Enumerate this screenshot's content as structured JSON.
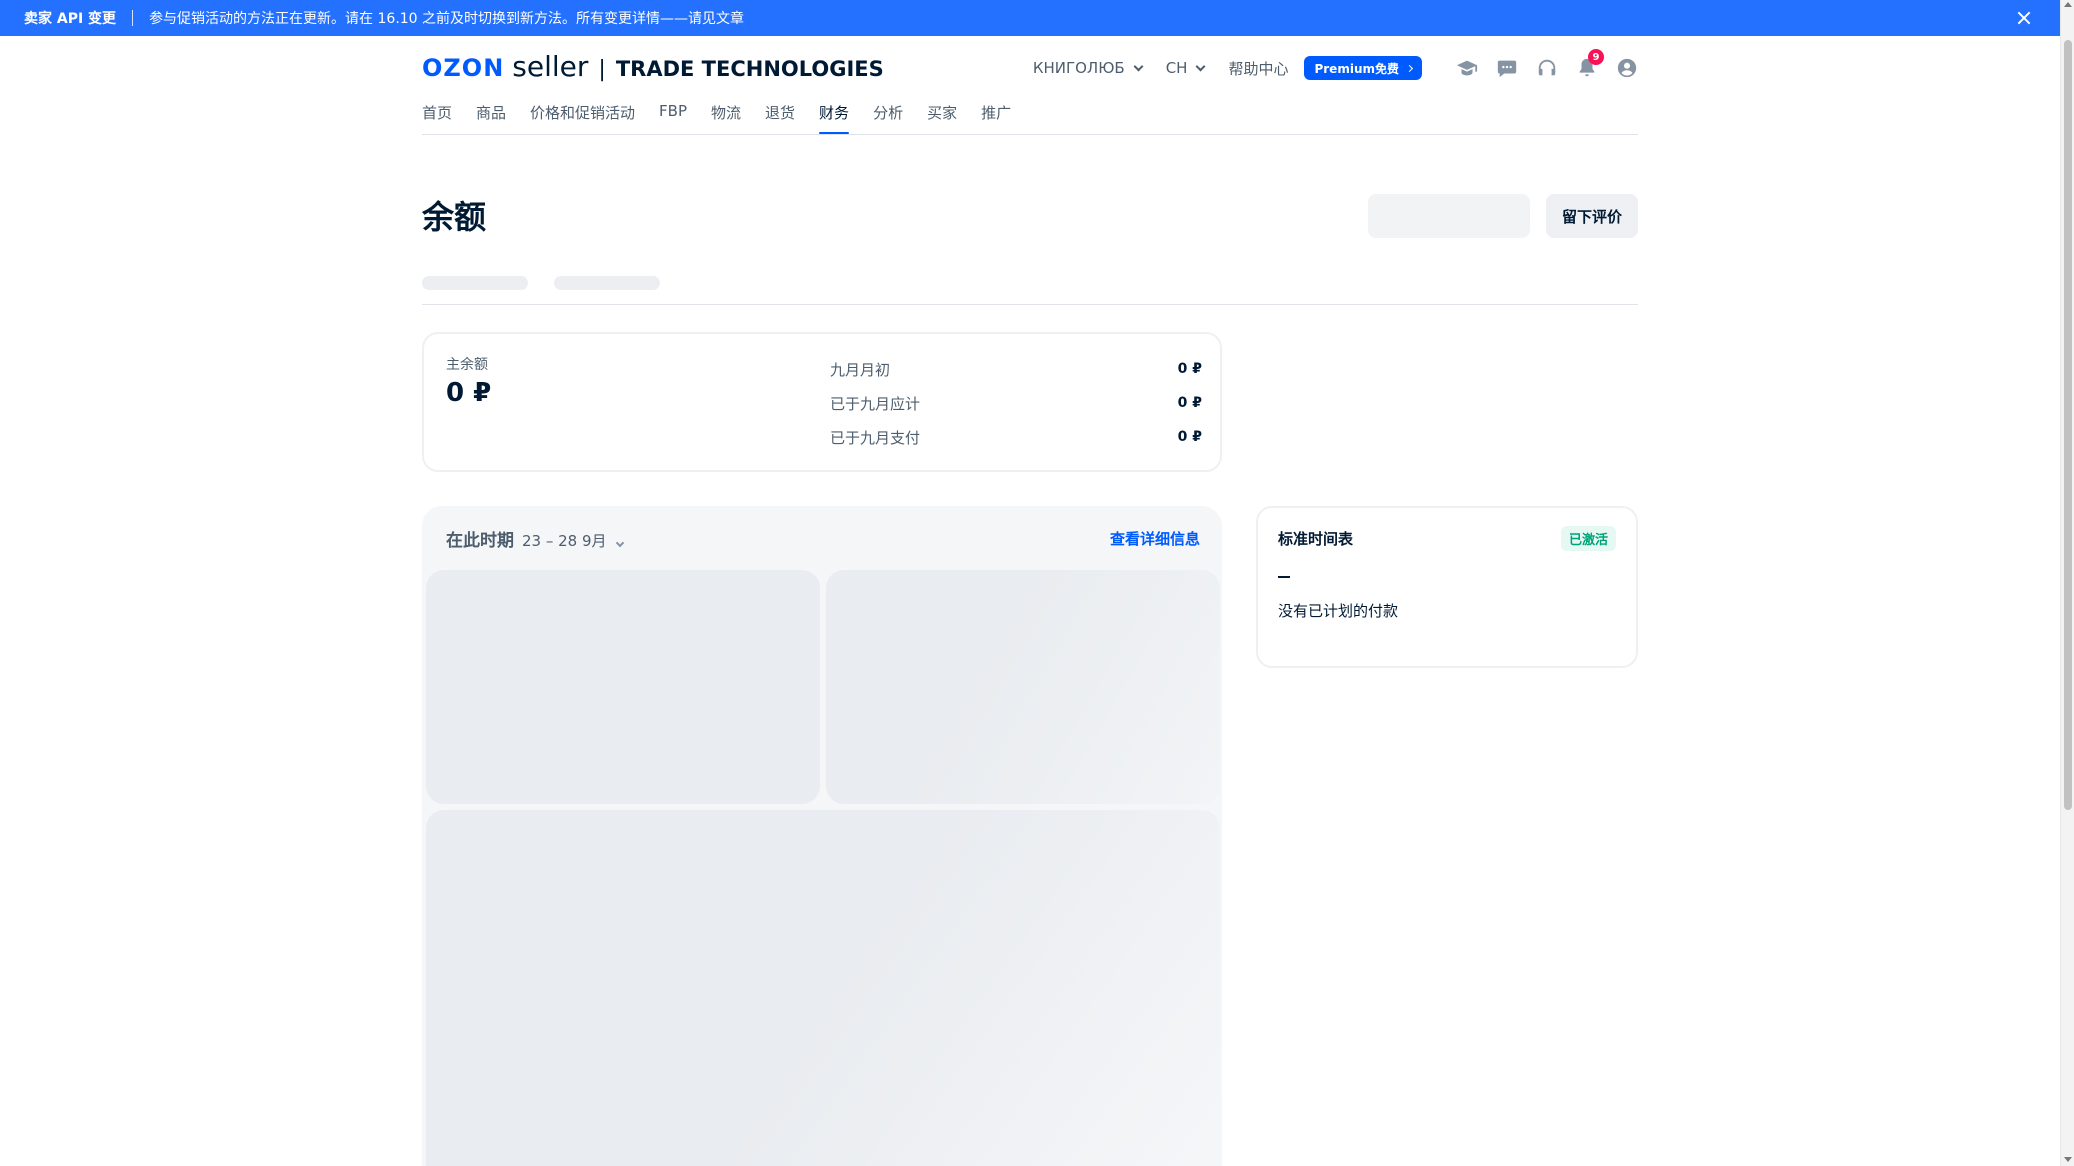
{
  "banner": {
    "tag": "卖家 API 变更",
    "message": "参与促销活动的方法正在更新。请在 16.10 之前及时切换到新方法。所有变更详情——请见文章"
  },
  "header": {
    "logo_ozon": "OZON",
    "logo_seller": "seller",
    "logo_bar": "|",
    "logo_trade": "TRADE TECHNOLOGIES",
    "company_select": "КНИГОЛЮБ",
    "lang_select": "CH",
    "help_center": "帮助中心",
    "premium": "Premium免费",
    "notifications_count": "9",
    "icons": [
      "graduation-cap-icon",
      "chat-icon",
      "headset-icon",
      "bell-icon",
      "user-icon"
    ]
  },
  "nav": {
    "items": [
      "首页",
      "商品",
      "价格和促销活动",
      "FBP",
      "物流",
      "退货",
      "财务",
      "分析",
      "买家",
      "推广"
    ],
    "active": "财务"
  },
  "page": {
    "title": "余额",
    "review_button": "留下评价"
  },
  "balance": {
    "main_label": "主余额",
    "main_value": "0 ₽",
    "rows": [
      {
        "label": "九月月初",
        "value": "0 ₽"
      },
      {
        "label": "已于九月应计",
        "value": "0 ₽"
      },
      {
        "label": "已于九月支付",
        "value": "0 ₽"
      }
    ]
  },
  "period": {
    "title": "在此时期",
    "dates": "23 – 28 9月",
    "details_link": "查看详细信息"
  },
  "schedule": {
    "title": "标准时间表",
    "status": "已激活",
    "empty_text": "没有已计划的付款"
  },
  "colors": {
    "banner": "#2470ff",
    "brand": "#005bff",
    "badge": "#f91155",
    "active_badge_text": "#00a378"
  }
}
